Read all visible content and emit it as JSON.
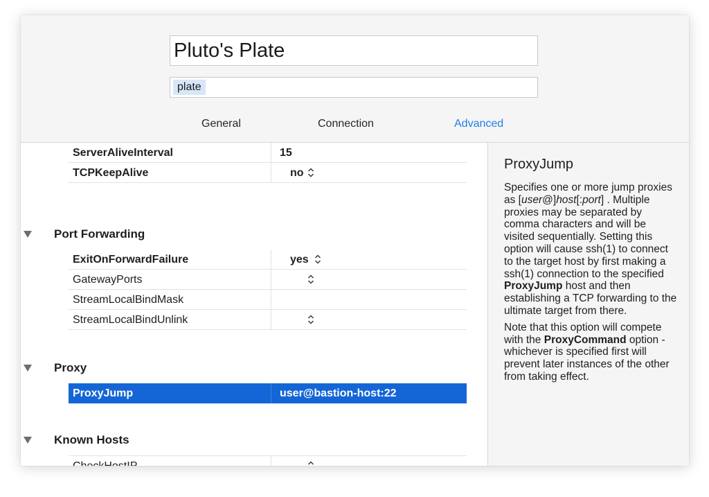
{
  "header": {
    "host_name": "Pluto's Plate",
    "alias_token": "plate"
  },
  "tabs": [
    {
      "label": "General",
      "active": false
    },
    {
      "label": "Connection",
      "active": false
    },
    {
      "label": "Advanced",
      "active": true
    }
  ],
  "colors": {
    "accent": "#1f7ee6",
    "selection": "#1466d6"
  },
  "rows_top": [
    {
      "key": "ServerAliveInterval",
      "value": "15"
    },
    {
      "key": "TCPKeepAlive",
      "value": "no"
    }
  ],
  "sections": {
    "port_forwarding": {
      "label": "Port Forwarding",
      "rows": [
        {
          "key": "ExitOnForwardFailure",
          "value": "yes"
        },
        {
          "key": "GatewayPorts",
          "value": ""
        },
        {
          "key": "StreamLocalBindMask",
          "value": ""
        },
        {
          "key": "StreamLocalBindUnlink",
          "value": ""
        }
      ]
    },
    "proxy": {
      "label": "Proxy",
      "rows": [
        {
          "key": "ProxyJump",
          "value": "user@bastion-host:22"
        }
      ]
    },
    "known_hosts": {
      "label": "Known Hosts",
      "rows": [
        {
          "key": "CheckHostIP",
          "value": ""
        }
      ]
    }
  },
  "help": {
    "title": "ProxyJump",
    "p1": {
      "t1": "Specifies one or more jump proxies as [",
      "user": "user",
      "t2": "@]",
      "host": "host",
      "t3": "[:",
      "port": "port",
      "t4": "] . Multiple proxies may be separated by comma characters and will be visited sequentially. Setting this option will cause ssh(1) to connect to the target host by first making a ssh(1) connection to the specified ",
      "bold": "ProxyJump",
      "t5": " host and then establishing a TCP forwarding to the ultimate target from there."
    },
    "p2": {
      "t1": "Note that this option will compete with the ",
      "bold": "ProxyCommand",
      "t2": " option - whichever is specified first will prevent later instances of the other from taking effect."
    }
  }
}
